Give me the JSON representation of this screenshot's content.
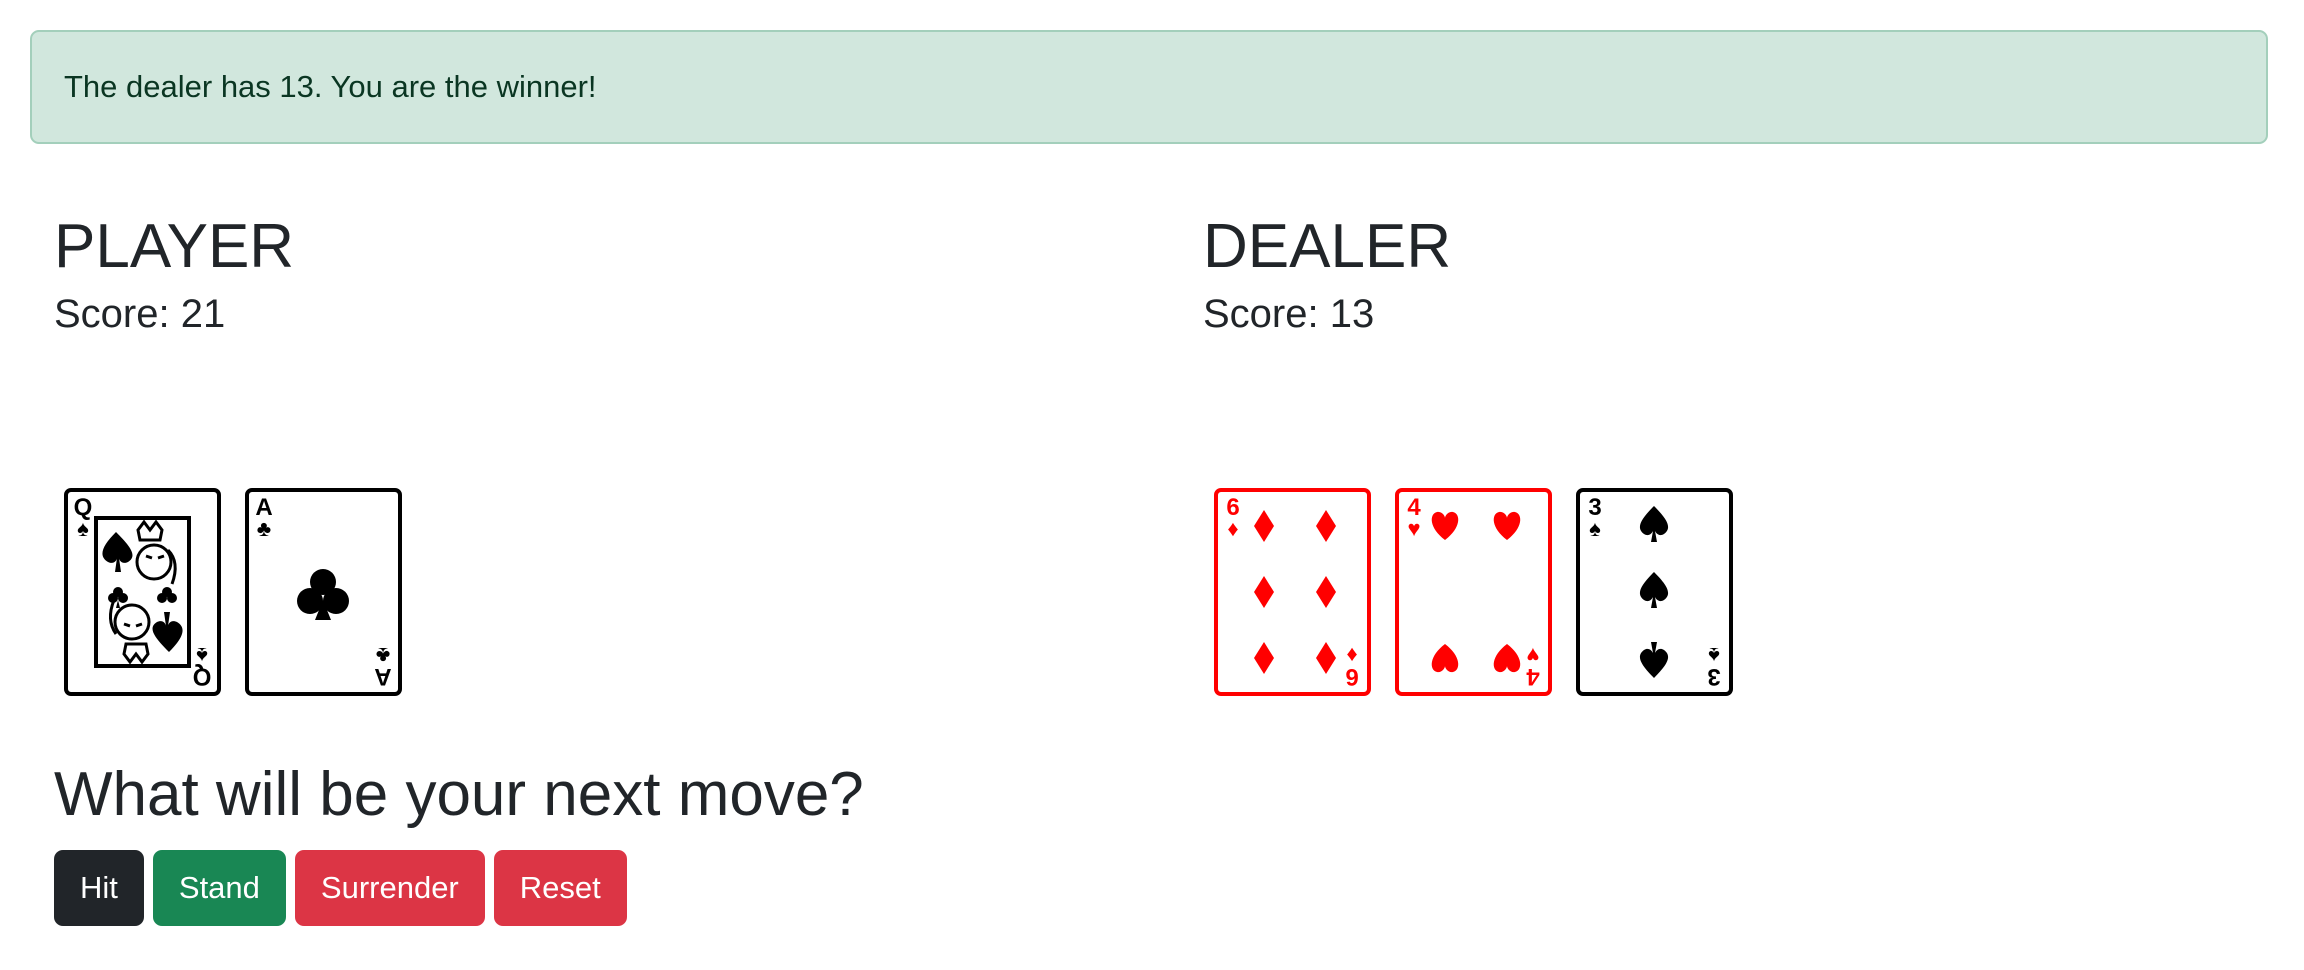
{
  "alert": {
    "message": "The dealer has 13. You are the winner!"
  },
  "player": {
    "title": "PLAYER",
    "score_text": "Score: 21",
    "cards": [
      {
        "rank": "Q",
        "suit": "spades",
        "suit_glyph": "♠",
        "color": "#000000"
      },
      {
        "rank": "A",
        "suit": "clubs",
        "suit_glyph": "♣",
        "color": "#000000"
      }
    ]
  },
  "dealer": {
    "title": "DEALER",
    "score_text": "Score: 13",
    "cards": [
      {
        "rank": "6",
        "suit": "diamonds",
        "suit_glyph": "♦",
        "color": "#ff0000"
      },
      {
        "rank": "4",
        "suit": "hearts",
        "suit_glyph": "♥",
        "color": "#ff0000"
      },
      {
        "rank": "3",
        "suit": "spades",
        "suit_glyph": "♠",
        "color": "#000000"
      }
    ]
  },
  "prompt": "What will be your next move?",
  "actions": [
    {
      "label": "Hit",
      "color": "#212529"
    },
    {
      "label": "Stand",
      "color": "#198754"
    },
    {
      "label": "Surrender",
      "color": "#dc3545"
    },
    {
      "label": "Reset",
      "color": "#dc3545"
    }
  ]
}
